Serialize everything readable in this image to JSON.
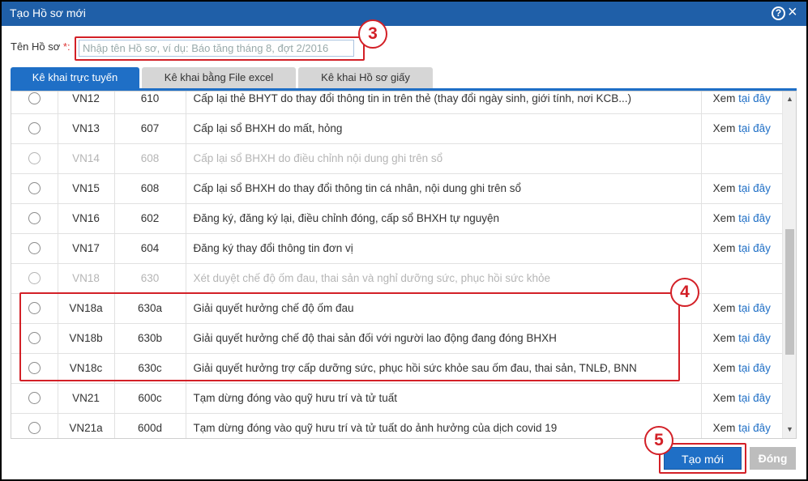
{
  "dialog": {
    "title": "Tạo Hồ sơ mới",
    "help_icon": "?",
    "close_icon": "×"
  },
  "name_field": {
    "label": "Tên Hồ sơ",
    "required_mark": "*:",
    "placeholder": "Nhập tên Hồ sơ, ví dụ: Báo tăng tháng 8, đợt 2/2016",
    "value": ""
  },
  "tabs": [
    {
      "label": "Kê khai trực tuyến",
      "active": true
    },
    {
      "label": "Kê khai bằng File excel",
      "active": false
    },
    {
      "label": "Kê khai Hồ sơ giấy",
      "active": false
    }
  ],
  "rows": [
    {
      "code": "VN12",
      "num": "610",
      "desc": "Cấp lại thẻ BHYT do thay đổi thông tin in trên thẻ (thay đổi ngày sinh, giới tính, nơi KCB...)",
      "view": "Xem",
      "link": "tại đây",
      "disabled": false
    },
    {
      "code": "VN13",
      "num": "607",
      "desc": "Cấp lại sổ BHXH do mất, hỏng",
      "view": "Xem",
      "link": "tại đây",
      "disabled": false
    },
    {
      "code": "VN14",
      "num": "608",
      "desc": "Cấp lại sổ BHXH do điều chỉnh nội dung ghi trên sổ",
      "view": "",
      "link": "",
      "disabled": true
    },
    {
      "code": "VN15",
      "num": "608",
      "desc": "Cấp lại sổ BHXH do thay đổi thông tin cá nhân, nội dung ghi trên sổ",
      "view": "Xem",
      "link": "tại đây",
      "disabled": false
    },
    {
      "code": "VN16",
      "num": "602",
      "desc": "Đăng ký, đăng ký lại, điều chỉnh đóng, cấp sổ BHXH tự nguyện",
      "view": "Xem",
      "link": "tại đây",
      "disabled": false
    },
    {
      "code": "VN17",
      "num": "604",
      "desc": "Đăng ký thay đổi thông tin đơn vị",
      "view": "Xem",
      "link": "tại đây",
      "disabled": false
    },
    {
      "code": "VN18",
      "num": "630",
      "desc": "Xét duyệt chế độ ốm đau, thai sản và nghỉ dưỡng sức, phục hồi sức khỏe",
      "view": "",
      "link": "",
      "disabled": true
    },
    {
      "code": "VN18a",
      "num": "630a",
      "desc": "Giải quyết hưởng chế độ ốm đau",
      "view": "Xem",
      "link": "tại đây",
      "disabled": false
    },
    {
      "code": "VN18b",
      "num": "630b",
      "desc": "Giải quyết hưởng chế độ thai sản đối với người lao động đang đóng BHXH",
      "view": "Xem",
      "link": "tại đây",
      "disabled": false
    },
    {
      "code": "VN18c",
      "num": "630c",
      "desc": "Giải quyết hưởng trợ cấp dưỡng sức, phục hồi sức khỏe sau ốm đau, thai sản, TNLĐ, BNN",
      "view": "Xem",
      "link": "tại đây",
      "disabled": false
    },
    {
      "code": "VN21",
      "num": "600c",
      "desc": "Tạm dừng đóng vào quỹ hưu trí và tử tuất",
      "view": "Xem",
      "link": "tại đây",
      "disabled": false
    },
    {
      "code": "VN21a",
      "num": "600d",
      "desc": "Tạm dừng đóng vào quỹ hưu trí và tử tuất do ảnh hưởng của dịch covid 19",
      "view": "Xem",
      "link": "tại đây",
      "disabled": false
    }
  ],
  "callouts": {
    "c3": "3",
    "c4": "4",
    "c5": "5"
  },
  "buttons": {
    "create": "Tạo mới",
    "close": "Đóng"
  },
  "colors": {
    "titlebar": "#1f5fa8",
    "accent": "#1f6fc6",
    "callout": "#d32027"
  }
}
